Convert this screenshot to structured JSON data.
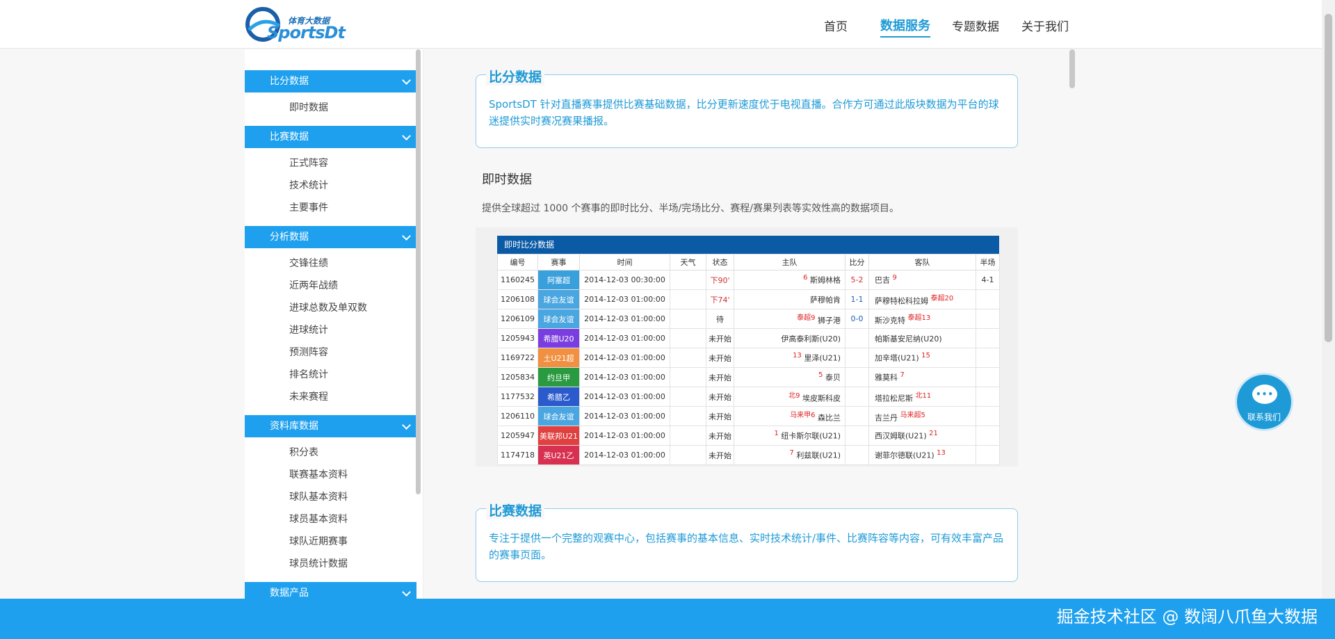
{
  "brand": {
    "logo_cn": "体育大数据",
    "logo_en": "SportsDt"
  },
  "nav": [
    {
      "label": "首页"
    },
    {
      "label": "数据服务"
    },
    {
      "label": "专题数据"
    },
    {
      "label": "关于我们"
    }
  ],
  "sidebar": {
    "groups": [
      {
        "label": "比分数据",
        "items": [
          "即时数据"
        ]
      },
      {
        "label": "比赛数据",
        "items": [
          "正式阵容",
          "技术统计",
          "主要事件"
        ]
      },
      {
        "label": "分析数据",
        "items": [
          "交锋往绩",
          "近两年战绩",
          "进球总数及单双数",
          "进球统计",
          "预测阵容",
          "排名统计",
          "未来赛程"
        ]
      },
      {
        "label": "资料库数据",
        "items": [
          "积分表",
          "联赛基本资料",
          "球队基本资料",
          "球员基本资料",
          "球队近期赛事",
          "球员统计数据"
        ]
      },
      {
        "label": "数据产品",
        "items": []
      }
    ]
  },
  "main": {
    "score_box": {
      "title": "比分数据",
      "desc": "SportsDT 针对直播赛事提供比赛基础数据，比分更新速度优于电视直播。合作方可通过此版块数据为平台的球迷提供实时赛况赛果播报。"
    },
    "live": {
      "title": "即时数据",
      "desc": "提供全球超过 1000 个赛事的即时比分、半场/完场比分、赛程/赛果列表等实效性高的数据项目。",
      "table_title": "即时比分数据",
      "headers": [
        "编号",
        "赛事",
        "时间",
        "天气",
        "状态",
        "主队",
        "比分",
        "客队",
        "半场"
      ],
      "rows": [
        {
          "id": "1160245",
          "league": "阿塞超",
          "league_color": "#3aa0dc",
          "time": "2014-12-03 00:30:00",
          "weather": "",
          "status": "下90'",
          "home_rank": "6",
          "home": "斯姆林格",
          "score": "5-2",
          "score_red": true,
          "away": "巴吉",
          "away_rank": "9",
          "half": "4-1"
        },
        {
          "id": "1206108",
          "league": "球会友谊",
          "league_color": "#4aa6e0",
          "time": "2014-12-03 01:00:00",
          "weather": "",
          "status": "下74'",
          "home_rank": "",
          "home": "萨穆帕肯",
          "score": "1-1",
          "score_red": false,
          "away": "萨穆特松科拉姆",
          "away_rank": "泰超20",
          "half": ""
        },
        {
          "id": "1206109",
          "league": "球会友谊",
          "league_color": "#4aa6e0",
          "time": "2014-12-03 01:00:00",
          "weather": "",
          "status": "待",
          "home_rank": "泰超9",
          "home": "狮子港",
          "score": "0-0",
          "score_red": false,
          "away": "斯沙克特",
          "away_rank": "泰超13",
          "half": ""
        },
        {
          "id": "1205943",
          "league": "希腊U20",
          "league_color": "#7a3ee0",
          "time": "2014-12-03 01:00:00",
          "weather": "",
          "status": "未开始",
          "home_rank": "",
          "home": "伊高泰利斯(U20)",
          "score": "",
          "score_red": false,
          "away": "帕斯基安尼纳(U20)",
          "away_rank": "",
          "half": ""
        },
        {
          "id": "1169722",
          "league": "土U21超",
          "league_color": "#f09040",
          "time": "2014-12-03 01:00:00",
          "weather": "",
          "status": "未开始",
          "home_rank": "13",
          "home": "里泽(U21)",
          "score": "",
          "score_red": false,
          "away": "加辛塔(U21)",
          "away_rank": "15",
          "half": ""
        },
        {
          "id": "1205834",
          "league": "约旦甲",
          "league_color": "#2a9a40",
          "time": "2014-12-03 01:00:00",
          "weather": "",
          "status": "未开始",
          "home_rank": "5",
          "home": "泰贝",
          "score": "",
          "score_red": false,
          "away": "雅莫科",
          "away_rank": "7",
          "half": ""
        },
        {
          "id": "1177532",
          "league": "希腊乙",
          "league_color": "#2a5acc",
          "time": "2014-12-03 01:00:00",
          "weather": "",
          "status": "未开始",
          "home_rank": "北9",
          "home": "埃皮斯科皮",
          "score": "",
          "score_red": false,
          "away": "塔拉松尼斯",
          "away_rank": "北11",
          "half": ""
        },
        {
          "id": "1206110",
          "league": "球会友谊",
          "league_color": "#4aa6e0",
          "time": "2014-12-03 01:00:00",
          "weather": "",
          "status": "未开始",
          "home_rank": "马来甲6",
          "home": "森比兰",
          "score": "",
          "score_red": false,
          "away": "吉兰丹",
          "away_rank": "马来超5",
          "half": ""
        },
        {
          "id": "1205947",
          "league": "美联邦U21",
          "league_color": "#e04040",
          "time": "2014-12-03 01:00:00",
          "weather": "",
          "status": "未开始",
          "home_rank": "1",
          "home": "纽卡斯尔联(U21)",
          "score": "",
          "score_red": false,
          "away": "西汉姆联(U21)",
          "away_rank": "21",
          "half": ""
        },
        {
          "id": "1174718",
          "league": "英U21乙",
          "league_color": "#d83050",
          "time": "2014-12-03 01:00:00",
          "weather": "",
          "status": "未开始",
          "home_rank": "7",
          "home": "利兹联(U21)",
          "score": "",
          "score_red": false,
          "away": "谢菲尔德联(U21)",
          "away_rank": "13",
          "half": ""
        }
      ]
    },
    "match_box": {
      "title": "比赛数据",
      "desc": "专注于提供一个完整的观赛中心，包括赛事的基本信息、实时技术统计/事件、比赛阵容等内容，可有效丰富产品的赛事页面。"
    }
  },
  "chat": {
    "label": "联系我们",
    "icon": "chat-bubble-icon"
  },
  "footer": {
    "watermark": "掘金技术社区 @ 数阔八爪鱼大数据"
  },
  "colors": {
    "accent": "#1ea0ee",
    "nav_active": "#1e9ad6",
    "table_header": "#0b5aa6"
  }
}
